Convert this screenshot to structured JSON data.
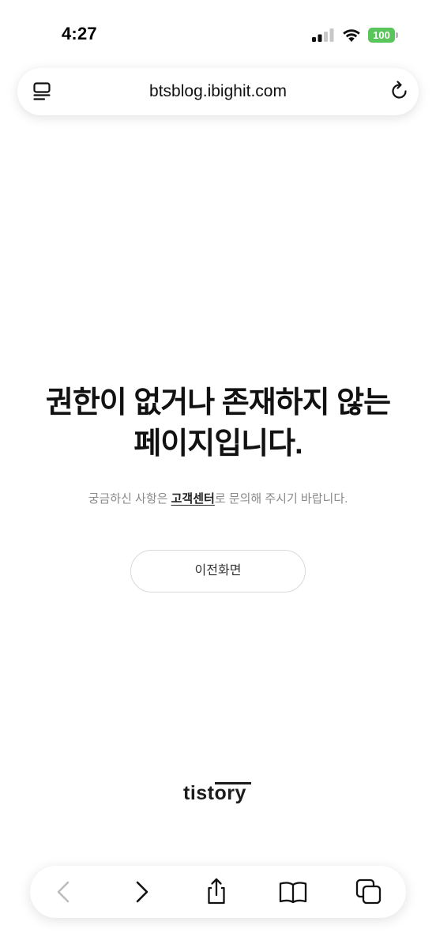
{
  "status_bar": {
    "time": "4:27",
    "battery_level": "100",
    "signal_icon": "cellular-signal-icon",
    "wifi_icon": "wifi-icon",
    "battery_color": "#5ac55a"
  },
  "browser": {
    "url": "btsblog.ibighit.com",
    "reader_icon": "reader-mode-icon",
    "reload_icon": "reload-icon"
  },
  "error_page": {
    "title_line1": "권한이 없거나 존재하지 않는",
    "title_line2": "페이지입니다.",
    "subtext_before": "궁금하신 사항은 ",
    "subtext_link": "고객센터",
    "subtext_after": "로 문의해 주시기 바랍니다.",
    "back_button_label": "이전화면"
  },
  "brand": {
    "logo_text": "tistory"
  },
  "toolbar": {
    "items": [
      {
        "icon": "back-arrow-icon",
        "enabled": false
      },
      {
        "icon": "forward-arrow-icon",
        "enabled": true
      },
      {
        "icon": "share-icon",
        "enabled": true
      },
      {
        "icon": "bookmarks-icon",
        "enabled": true
      },
      {
        "icon": "tabs-icon",
        "enabled": true
      }
    ]
  }
}
